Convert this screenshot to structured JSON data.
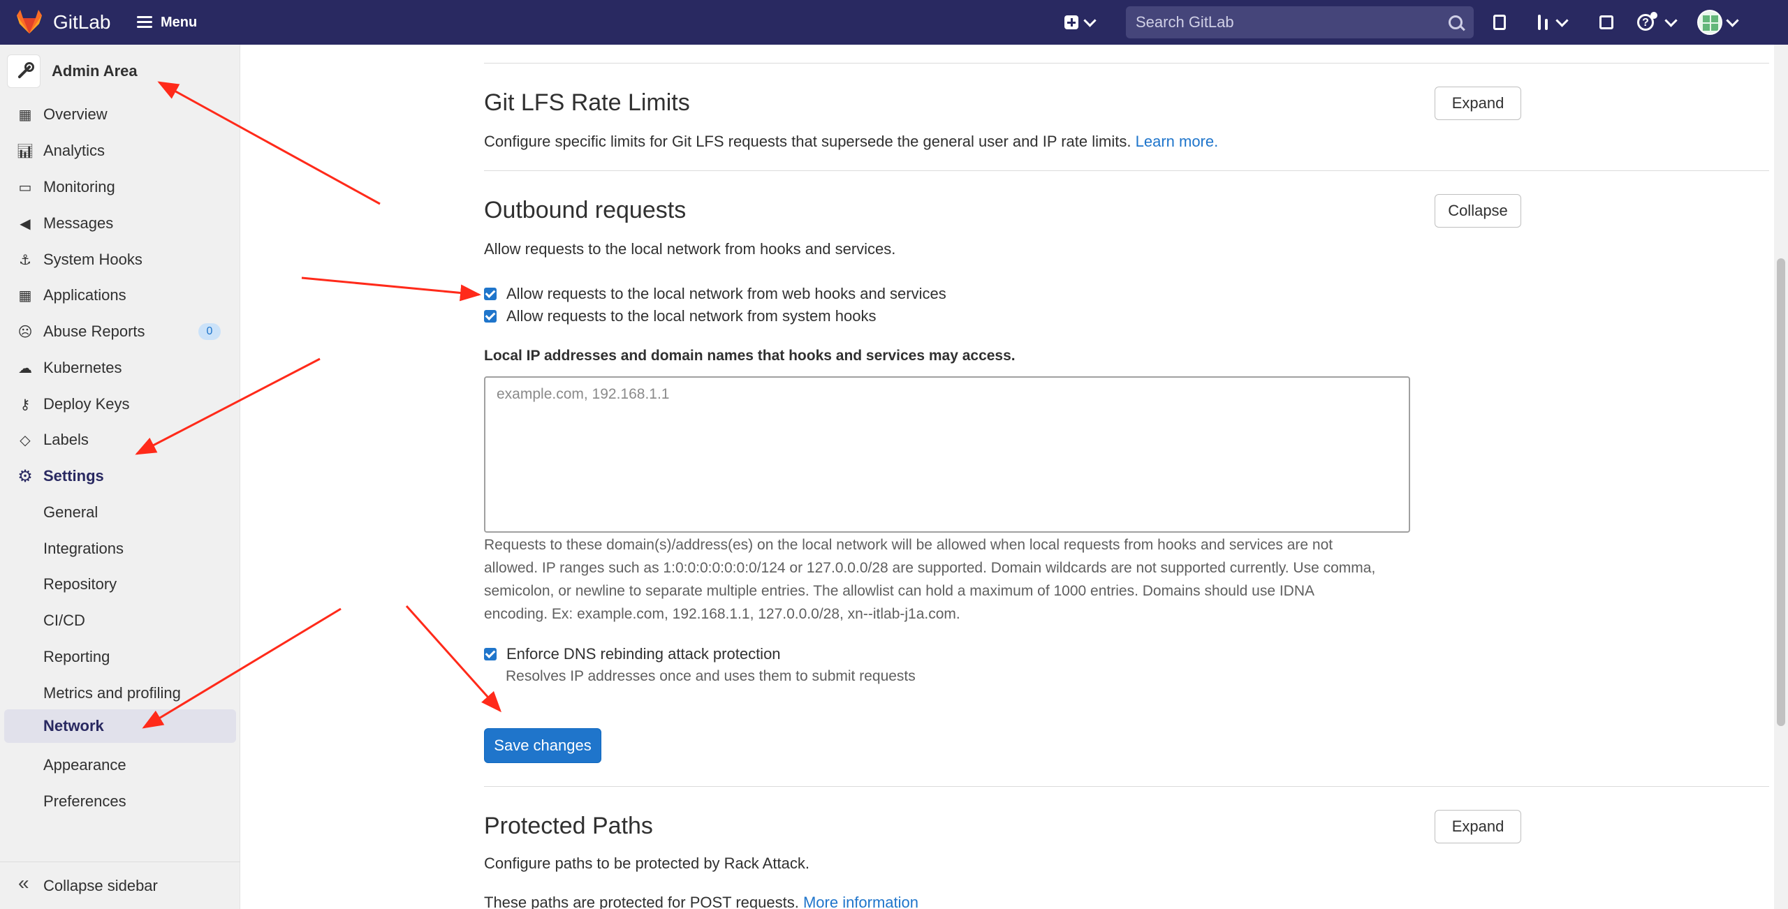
{
  "topbar": {
    "brand": "GitLab",
    "menu_label": "Menu",
    "search_placeholder": "Search GitLab"
  },
  "sidebar": {
    "header": "Admin Area",
    "items": [
      {
        "label": "Overview",
        "icon": "overview-icon"
      },
      {
        "label": "Analytics",
        "icon": "chart-icon"
      },
      {
        "label": "Monitoring",
        "icon": "monitor-icon"
      },
      {
        "label": "Messages",
        "icon": "bullhorn-icon"
      },
      {
        "label": "System Hooks",
        "icon": "hook-icon"
      },
      {
        "label": "Applications",
        "icon": "applications-icon"
      },
      {
        "label": "Abuse Reports",
        "icon": "smiley-icon",
        "count": "0"
      },
      {
        "label": "Kubernetes",
        "icon": "cloud-gear-icon"
      },
      {
        "label": "Deploy Keys",
        "icon": "key-icon"
      },
      {
        "label": "Labels",
        "icon": "label-icon"
      },
      {
        "label": "Settings",
        "icon": "gear-icon"
      }
    ],
    "settings_sub": [
      "General",
      "Integrations",
      "Repository",
      "CI/CD",
      "Reporting",
      "Metrics and profiling",
      "Network",
      "Appearance",
      "Preferences"
    ],
    "active_sub": "Network",
    "collapse_label": "Collapse sidebar"
  },
  "main": {
    "lfs": {
      "title": "Git LFS Rate Limits",
      "desc": "Configure specific limits for Git LFS requests that supersede the general user and IP rate limits.",
      "link": "Learn more.",
      "button": "Expand"
    },
    "outbound": {
      "title": "Outbound requests",
      "desc": "Allow requests to the local network from hooks and services.",
      "button": "Collapse",
      "cb_webhooks": "Allow requests to the local network from web hooks and services",
      "cb_system": "Allow requests to the local network from system hooks",
      "allowlist_label": "Local IP addresses and domain names that hooks and services may access.",
      "allowlist_placeholder": "example.com, 192.168.1.1",
      "help_lines": [
        "Requests to these domain(s)/address(es) on the local network will be allowed when local requests from hooks and services are not",
        "allowed. IP ranges such as 1:0:0:0:0:0:0:0/124 or 127.0.0.0/28 are supported. Domain wildcards are not supported currently. Use comma,",
        "semicolon, or newline to separate multiple entries. The allowlist can hold a maximum of 1000 entries. Domains should use IDNA",
        "encoding. Ex: example.com, 192.168.1.1, 127.0.0.0/28, xn--itlab-j1a.com."
      ],
      "cb_dns": "Enforce DNS rebinding attack protection",
      "dns_help": "Resolves IP addresses once and uses them to submit requests",
      "save": "Save changes"
    },
    "protected": {
      "title": "Protected Paths",
      "desc": "Configure paths to be protected by Rack Attack.",
      "partial": "These paths are protected for POST requests.",
      "link": "More information",
      "button": "Expand"
    }
  },
  "colors": {
    "topbar": "#292961",
    "primary": "#1f75cb",
    "annotation_arrow": "#ff2a1a"
  }
}
